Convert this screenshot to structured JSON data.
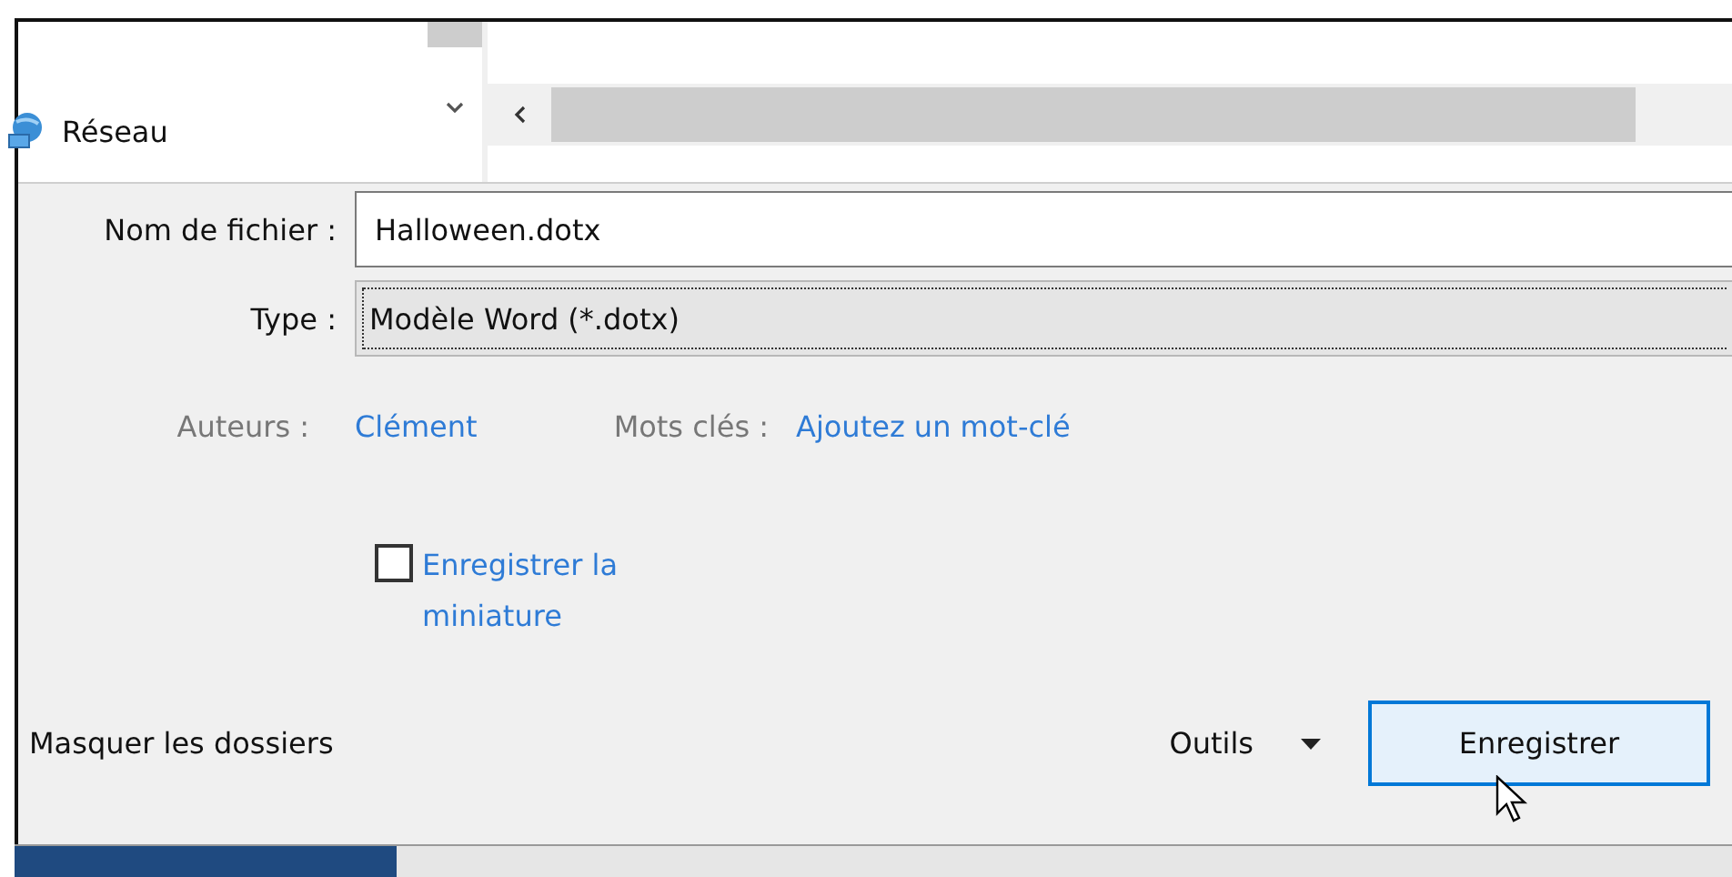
{
  "navigation": {
    "items": [
      {
        "label": "Réseau",
        "selected": false
      }
    ]
  },
  "form": {
    "file_name": {
      "label": "Nom de fichier :",
      "value": "Halloween.dotx"
    },
    "type": {
      "label": "Type :",
      "value": "Modèle Word (*.dotx)"
    },
    "authors": {
      "label": "Auteurs :",
      "value": "Clément"
    },
    "keywords": {
      "label": "Mots clés :",
      "placeholder": "Ajoutez un mot-clé"
    },
    "thumbnail": {
      "label": "Enregistrer la miniature",
      "checked": false
    }
  },
  "footer": {
    "toggle_folders": "Masquer les dossiers",
    "tools": "Outils",
    "save": "Enregistrer"
  }
}
